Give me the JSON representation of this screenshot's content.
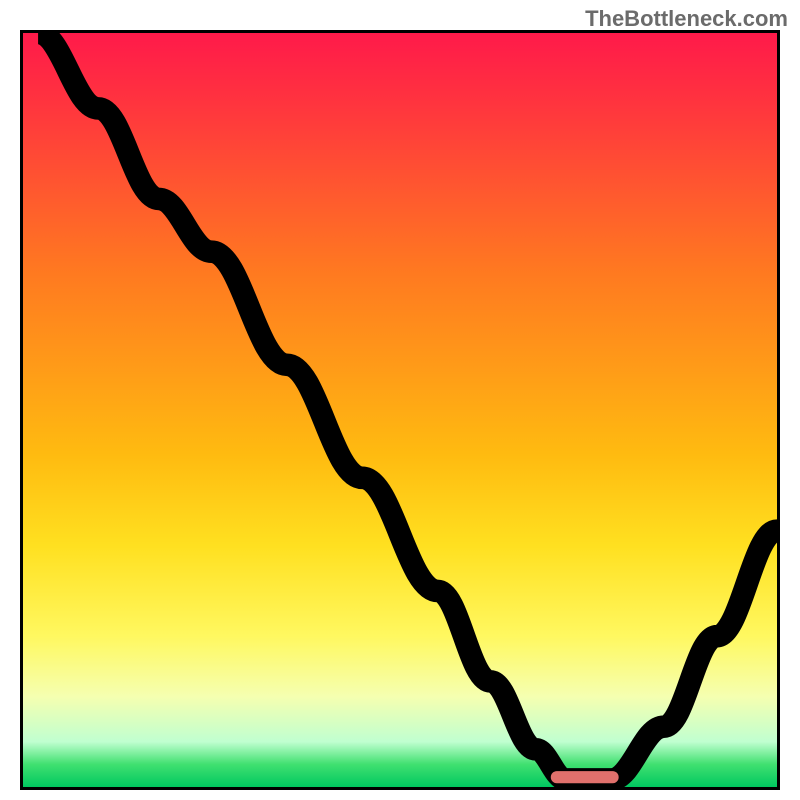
{
  "watermark": "TheBottleneck.com",
  "chart_data": {
    "type": "line",
    "title": "",
    "xlabel": "",
    "ylabel": "",
    "xlim": [
      0,
      100
    ],
    "ylim": [
      0,
      100
    ],
    "series": [
      {
        "name": "curve",
        "x": [
          2,
          10,
          18,
          25,
          35,
          45,
          55,
          62,
          68,
          72,
          78,
          85,
          92,
          100
        ],
        "y": [
          100,
          90,
          78,
          71,
          56,
          41,
          26,
          14,
          5,
          1,
          1,
          8,
          20,
          34
        ]
      }
    ],
    "marker": {
      "x_start": 70,
      "x_end": 79,
      "y": 0.5
    },
    "background_gradient": {
      "stops": [
        {
          "pos": 0,
          "color": "#ff1a4a"
        },
        {
          "pos": 8,
          "color": "#ff3040"
        },
        {
          "pos": 20,
          "color": "#ff5530"
        },
        {
          "pos": 32,
          "color": "#ff7a20"
        },
        {
          "pos": 44,
          "color": "#ff9a18"
        },
        {
          "pos": 56,
          "color": "#ffbb10"
        },
        {
          "pos": 68,
          "color": "#ffe020"
        },
        {
          "pos": 80,
          "color": "#fff860"
        },
        {
          "pos": 88,
          "color": "#f5ffb0"
        },
        {
          "pos": 94,
          "color": "#c0ffd0"
        },
        {
          "pos": 97,
          "color": "#40e070"
        },
        {
          "pos": 100,
          "color": "#00c860"
        }
      ]
    }
  }
}
